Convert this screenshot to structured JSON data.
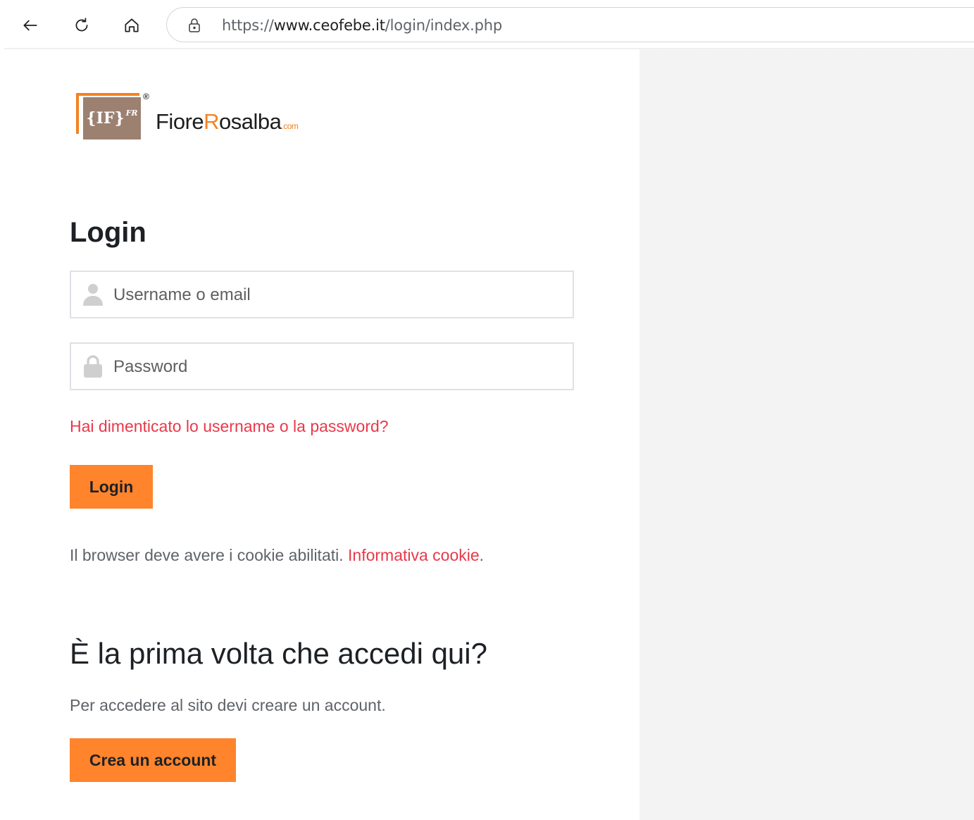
{
  "browser": {
    "url_prefix": "https://",
    "url_host": "www.ceofebe.it",
    "url_path": "/login/index.php"
  },
  "logo": {
    "mark": "{IF}",
    "mark_sup": "FR",
    "registered": "®",
    "word_a": "Fiore",
    "word_b": "R",
    "word_c": "osalba",
    "word_suffix": ".com",
    "accent_color": "#f58220"
  },
  "login": {
    "title": "Login",
    "username_placeholder": "Username o email",
    "password_placeholder": "Password",
    "forgot_link": "Hai dimenticato lo username o la password?",
    "login_button": "Login",
    "cookie_text": "Il browser deve avere i cookie abilitati.",
    "cookie_link": "Informativa cookie",
    "cookie_period": "."
  },
  "signup": {
    "title": "È la prima volta che accedi qui?",
    "description": "Per accedere al sito devi creare un account.",
    "button": "Crea un account"
  },
  "colors": {
    "button": "#ff842c",
    "link": "#e8394a",
    "side_panel": "#f3f3f3"
  }
}
